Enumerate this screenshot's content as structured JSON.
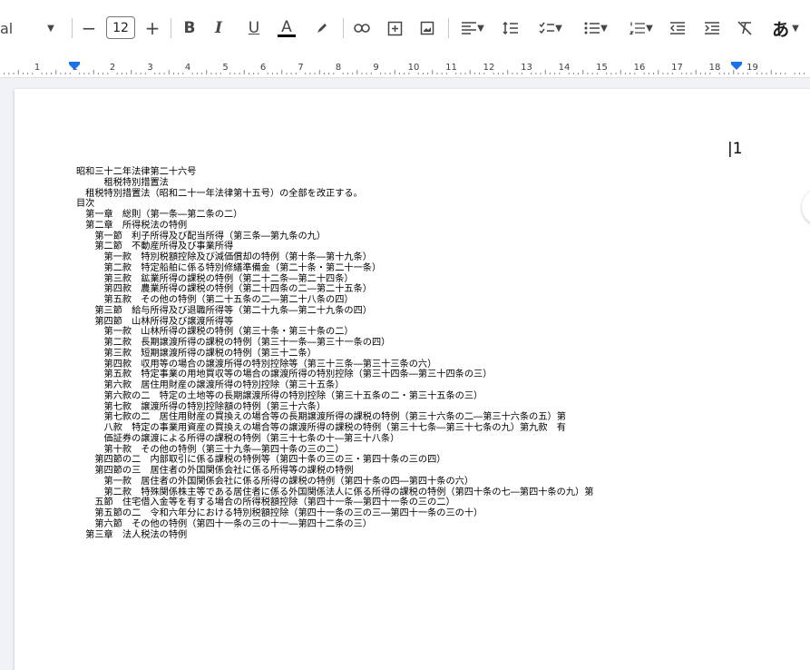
{
  "toolbar": {
    "font_name": "al",
    "font_size": "12",
    "minus": "−",
    "plus": "+",
    "bold": "B",
    "italic": "I",
    "underline": "U",
    "text_color_letter": "A",
    "ime_char": "あ",
    "text_color_underline": "#000000"
  },
  "ruler": {
    "labels": [
      "1",
      "1",
      "2",
      "3",
      "4",
      "5",
      "6",
      "7",
      "8",
      "9",
      "10",
      "11",
      "12",
      "13",
      "14",
      "15",
      "16",
      "17",
      "18",
      "19"
    ],
    "marker_color": "#1a73e8"
  },
  "document": {
    "cursor_glyph": "|1",
    "lines": [
      "昭和三十二年法律第二十六号",
      "　　　租税特別措置法",
      "　租税特別措置法（昭和二十一年法律第十五号）の全部を改正する。",
      "目次",
      "　第一章　総則（第一条―第二条の二）",
      "　第二章　所得税法の特例",
      "　　第一節　利子所得及び配当所得（第三条―第九条の九）",
      "　　第二節　不動産所得及び事業所得",
      "　　　第一款　特別税額控除及び減価償却の特例（第十条―第十九条）",
      "　　　第二款　特定船舶に係る特別修繕準備金（第二十条・第二十一条）",
      "　　　第三款　鉱業所得の課税の特例（第二十二条―第二十四条）",
      "　　　第四款　農業所得の課税の特例（第二十四条の二―第二十五条）",
      "　　　第五款　その他の特例（第二十五条の二―第二十八条の四）",
      "　　第三節　給与所得及び退職所得等（第二十九条―第二十九条の四）",
      "　　第四節　山林所得及び譲渡所得等",
      "　　　第一款　山林所得の課税の特例（第三十条・第三十条の二）",
      "　　　第二款　長期譲渡所得の課税の特例（第三十一条―第三十一条の四）",
      "　　　第三款　短期譲渡所得の課税の特例（第三十二条）",
      "　　　第四款　収用等の場合の譲渡所得の特別控除等（第三十三条―第三十三条の六）",
      "　　　第五款　特定事業の用地買収等の場合の譲渡所得の特別控除（第三十四条―第三十四条の三）",
      "　　　第六款　居住用財産の譲渡所得の特別控除（第三十五条）",
      "　　　第六款の二　特定の土地等の長期譲渡所得の特別控除（第三十五条の二・第三十五条の三）",
      "　　　第七款　譲渡所得の特別控除額の特例（第三十六条）",
      "　　　第七款の二　居住用財産の買換えの場合等の長期譲渡所得の課税の特例（第三十六条の二―第三十六条の五）第",
      "　　　八款　特定の事業用資産の買換えの場合等の譲渡所得の課税の特例（第三十七条―第三十七条の九）第九款　有",
      "　　　価証券の譲渡による所得の課税の特例（第三十七条の十―第三十八条）",
      "　　　第十款　その他の特例（第三十九条―第四十条の三の二）",
      "　　第四節の二　内部取引に係る課税の特例等（第四十条の三の三・第四十条の三の四）",
      "　　第四節の三　居住者の外国関係会社に係る所得等の課税の特例",
      "　　　第一款　居住者の外国関係会社に係る所得の課税の特例（第四十条の四―第四十条の六）",
      "　　　第二款　特殊関係株主等である居住者に係る外国関係法人に係る所得の課税の特例（第四十条の七―第四十条の九）第",
      "　　五節　住宅借入金等を有する場合の所得税額控除（第四十一条―第四十一条の三の二）",
      "　　第五節の二　令和六年分における特別税額控除（第四十一条の三の三―第四十一条の三の十）",
      "　　第六節　その他の特例（第四十一条の三の十一―第四十二条の三）",
      "　第三章　法人税法の特例"
    ]
  }
}
